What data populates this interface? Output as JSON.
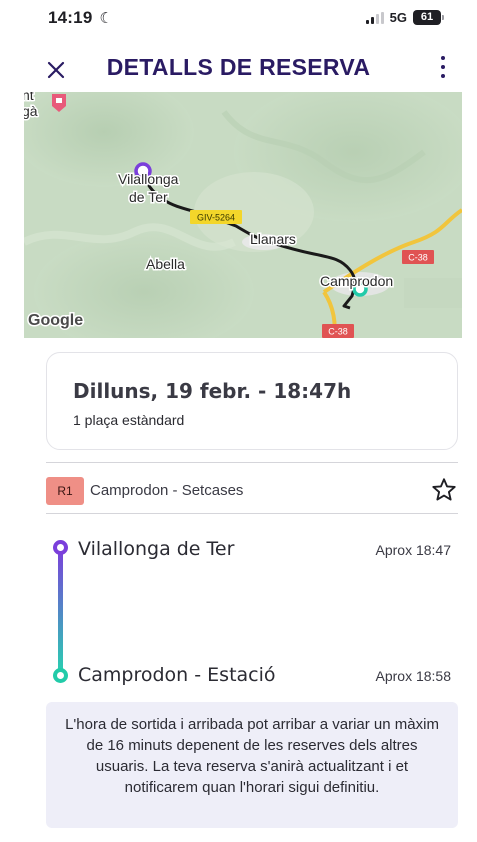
{
  "status": {
    "time": "14:19",
    "network": "5G",
    "battery": "61"
  },
  "header": {
    "title": "DETALLS DE RESERVA"
  },
  "map": {
    "labels": {
      "top_left_1": "nt",
      "top_left_2": "gà",
      "vilallonga_1": "Vilallonga",
      "vilallonga_2": "de Ter",
      "road_giv": "GIV-5264",
      "llanars": "Llanars",
      "abella": "Abella",
      "camprodon": "Camprodon",
      "road_c38_top": "C-38",
      "road_c38_bottom": "C-38",
      "attribution": "Google"
    },
    "colors": {
      "route_line": "#1a1a1a",
      "origin_pin": "#7b3fdb",
      "destination_pin": "#22cba9",
      "road_badge": "#f3d62a",
      "highway_badge": "#e05353"
    }
  },
  "booking": {
    "date": "Dilluns, 19 febr. - 18:47h",
    "seats": "1 plaça estàndard"
  },
  "route": {
    "badge": "R1",
    "name": "Camprodon - Setcases",
    "badge_color": "#ef8f86"
  },
  "stops": [
    {
      "name": "Vilallonga de Ter",
      "time": "Aprox 18:47"
    },
    {
      "name": "Camprodon - Estació",
      "time": "Aprox 18:58"
    }
  ],
  "notice": "L'hora de sortida i arribada pot arribar a variar un màxim de 16 minuts depenent de les reserves dels altres usuaris. La teva reserva s'anirà actualitzant i et notificarem quan l'horari sigui definitiu.",
  "icons": {
    "close": "close-icon",
    "more": "more-vertical-icon",
    "star": "star-outline-icon",
    "moon": "moon-icon"
  }
}
